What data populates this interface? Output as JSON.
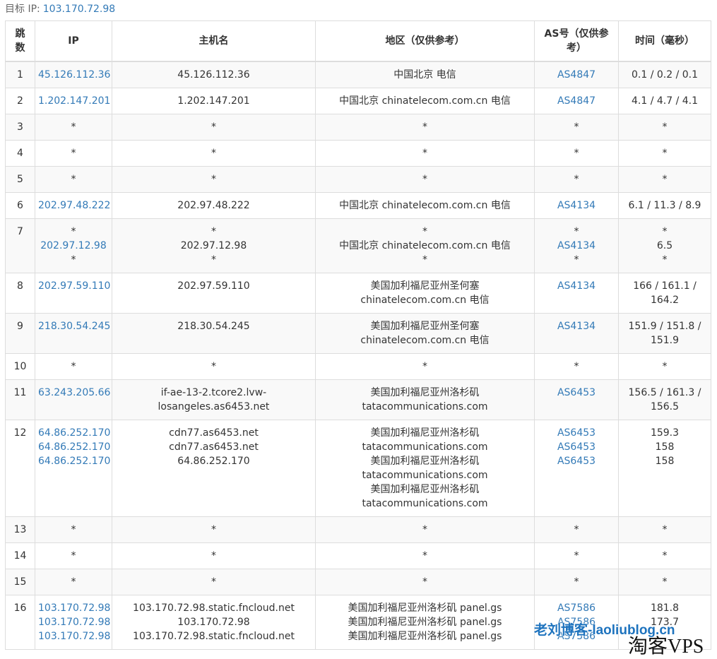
{
  "target": {
    "label": "目标 IP:",
    "ip": "103.170.72.98"
  },
  "columns": {
    "hop": "跳数",
    "ip": "IP",
    "host": "主机名",
    "region": "地区（仅供参考）",
    "as": "AS号（仅供参考）",
    "time": "时间（毫秒）"
  },
  "rows": [
    {
      "hop": "1",
      "ip": [
        "45.126.112.36"
      ],
      "host": [
        "45.126.112.36"
      ],
      "region": [
        "中国北京 电信"
      ],
      "as": [
        "AS4847"
      ],
      "time": [
        "0.1 / 0.2 / 0.1"
      ]
    },
    {
      "hop": "2",
      "ip": [
        "1.202.147.201"
      ],
      "host": [
        "1.202.147.201"
      ],
      "region": [
        "中国北京 chinatelecom.com.cn 电信"
      ],
      "as": [
        "AS4847"
      ],
      "time": [
        "4.1 / 4.7 / 4.1"
      ]
    },
    {
      "hop": "3",
      "ip": [
        "*"
      ],
      "host": [
        "*"
      ],
      "region": [
        "*"
      ],
      "as": [
        "*"
      ],
      "time": [
        "*"
      ]
    },
    {
      "hop": "4",
      "ip": [
        "*"
      ],
      "host": [
        "*"
      ],
      "region": [
        "*"
      ],
      "as": [
        "*"
      ],
      "time": [
        "*"
      ]
    },
    {
      "hop": "5",
      "ip": [
        "*"
      ],
      "host": [
        "*"
      ],
      "region": [
        "*"
      ],
      "as": [
        "*"
      ],
      "time": [
        "*"
      ]
    },
    {
      "hop": "6",
      "ip": [
        "202.97.48.222"
      ],
      "host": [
        "202.97.48.222"
      ],
      "region": [
        "中国北京 chinatelecom.com.cn 电信"
      ],
      "as": [
        "AS4134"
      ],
      "time": [
        "6.1 / 11.3 / 8.9"
      ]
    },
    {
      "hop": "7",
      "ip": [
        "*",
        "202.97.12.98",
        "*"
      ],
      "host": [
        "*",
        "202.97.12.98",
        "*"
      ],
      "region": [
        "*",
        "中国北京 chinatelecom.com.cn 电信",
        "*"
      ],
      "as": [
        "*",
        "AS4134",
        "*"
      ],
      "time": [
        "*",
        "6.5",
        "*"
      ]
    },
    {
      "hop": "8",
      "ip": [
        "202.97.59.110"
      ],
      "host": [
        "202.97.59.110"
      ],
      "region": [
        "美国加利福尼亚州圣何塞",
        "chinatelecom.com.cn 电信"
      ],
      "as": [
        "AS4134"
      ],
      "time": [
        "166 / 161.1 /",
        "164.2"
      ]
    },
    {
      "hop": "9",
      "ip": [
        "218.30.54.245"
      ],
      "host": [
        "218.30.54.245"
      ],
      "region": [
        "美国加利福尼亚州圣何塞",
        "chinatelecom.com.cn 电信"
      ],
      "as": [
        "AS4134"
      ],
      "time": [
        "151.9 / 151.8 /",
        "151.9"
      ]
    },
    {
      "hop": "10",
      "ip": [
        "*"
      ],
      "host": [
        "*"
      ],
      "region": [
        "*"
      ],
      "as": [
        "*"
      ],
      "time": [
        "*"
      ]
    },
    {
      "hop": "11",
      "ip": [
        "63.243.205.66"
      ],
      "host": [
        "if-ae-13-2.tcore2.lvw-",
        "losangeles.as6453.net"
      ],
      "region": [
        "美国加利福尼亚州洛杉矶",
        "tatacommunications.com"
      ],
      "as": [
        "AS6453"
      ],
      "time": [
        "156.5 / 161.3 /",
        "156.5"
      ]
    },
    {
      "hop": "12",
      "ip": [
        "64.86.252.170",
        "64.86.252.170",
        "64.86.252.170"
      ],
      "host": [
        "cdn77.as6453.net",
        "cdn77.as6453.net",
        "64.86.252.170"
      ],
      "region": [
        "美国加利福尼亚州洛杉矶",
        "tatacommunications.com",
        "美国加利福尼亚州洛杉矶",
        "tatacommunications.com",
        "美国加利福尼亚州洛杉矶",
        "tatacommunications.com"
      ],
      "as": [
        "AS6453",
        "AS6453",
        "AS6453"
      ],
      "time": [
        "159.3",
        "158",
        "158"
      ]
    },
    {
      "hop": "13",
      "ip": [
        "*"
      ],
      "host": [
        "*"
      ],
      "region": [
        "*"
      ],
      "as": [
        "*"
      ],
      "time": [
        "*"
      ]
    },
    {
      "hop": "14",
      "ip": [
        "*"
      ],
      "host": [
        "*"
      ],
      "region": [
        "*"
      ],
      "as": [
        "*"
      ],
      "time": [
        "*"
      ]
    },
    {
      "hop": "15",
      "ip": [
        "*"
      ],
      "host": [
        "*"
      ],
      "region": [
        "*"
      ],
      "as": [
        "*"
      ],
      "time": [
        "*"
      ]
    },
    {
      "hop": "16",
      "ip": [
        "103.170.72.98",
        "103.170.72.98",
        "103.170.72.98"
      ],
      "host": [
        "103.170.72.98.static.fncloud.net",
        "103.170.72.98",
        "103.170.72.98.static.fncloud.net"
      ],
      "region": [
        "美国加利福尼亚州洛杉矶 panel.gs",
        "美国加利福尼亚州洛杉矶 panel.gs",
        "美国加利福尼亚州洛杉矶 panel.gs"
      ],
      "as": [
        "AS7586",
        "AS7586",
        "AS7586"
      ],
      "time": [
        "181.8",
        "173.7",
        ""
      ]
    }
  ],
  "watermark": {
    "blog": "老刘博客-laoliublog.cn",
    "site": "淘客VPS"
  },
  "colors": {
    "link": "#337ab7",
    "border": "#dddddd",
    "stripe": "#f9f9f9"
  }
}
